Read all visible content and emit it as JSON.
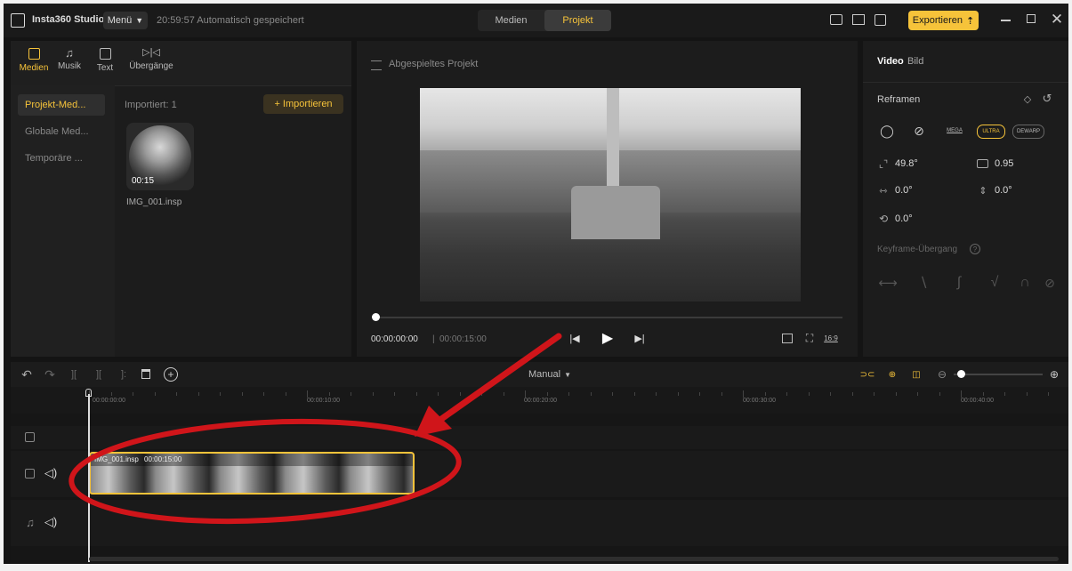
{
  "titlebar": {
    "app_name": "Insta360 Studio",
    "menu_label": "Menü",
    "autosave_text": "20:59:57 Automatisch gespeichert",
    "tabs": [
      {
        "label": "Medien",
        "active": false
      },
      {
        "label": "Projekt",
        "active": true
      }
    ],
    "export_label": "Exportieren",
    "accent_color": "#f6c33a"
  },
  "media_panel": {
    "tabs": [
      {
        "label": "Medien",
        "icon": "media-icon",
        "active": true
      },
      {
        "label": "Musik",
        "icon": "music-icon",
        "active": false
      },
      {
        "label": "Text",
        "icon": "text-icon",
        "active": false
      },
      {
        "label": "Übergänge",
        "icon": "transition-icon",
        "active": false
      }
    ],
    "categories": [
      {
        "label": "Projekt-Med...",
        "active": true
      },
      {
        "label": "Globale Med...",
        "active": false
      },
      {
        "label": "Temporäre ...",
        "active": false
      }
    ],
    "imported_label": "Importiert: 1",
    "import_button": "+ Importieren",
    "thumb": {
      "duration": "00:15",
      "filename": "IMG_001.insp"
    }
  },
  "preview": {
    "title": "Abgespieltes Projekt",
    "current_time": "00:00:00:00",
    "total_time": "00:00:15:00",
    "aspect_label": "16:9"
  },
  "inspector": {
    "tabs": [
      {
        "label": "Video",
        "active": true
      },
      {
        "label": "Bild",
        "active": false
      }
    ],
    "reframe_label": "Reframen",
    "lens_modes": [
      "MEGA",
      "ULTRA",
      "DEWARP"
    ],
    "values": {
      "fov": "49.8°",
      "distance": "0.95",
      "pan": "0.0°",
      "tilt": "0.0°",
      "roll": "0.0°"
    },
    "keyframe_label": "Keyframe-Übergang"
  },
  "timeline": {
    "mode_label": "Manual",
    "ruler": [
      "00:00:00:00",
      "00:00:10:00",
      "00:00:20:00",
      "00:00:30:00",
      "00:00:40:00"
    ],
    "clip": {
      "name": "IMG_001.insp",
      "duration": "00:00:15:00"
    }
  }
}
